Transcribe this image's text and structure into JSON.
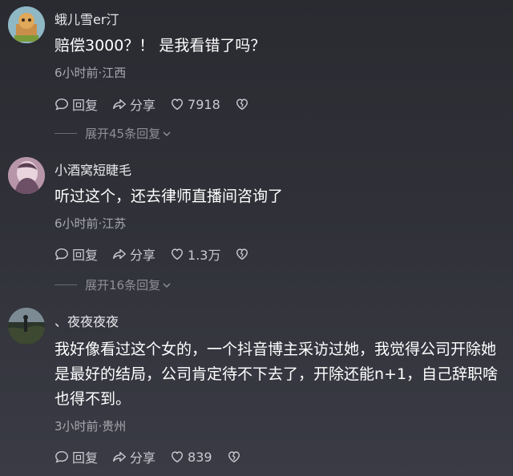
{
  "comments": [
    {
      "username": "蛾儿雪er汀",
      "text": "赔偿3000？！ 是我看错了吗？",
      "meta": "6小时前·江西",
      "reply_label": "回复",
      "share_label": "分享",
      "likes": "7918",
      "expand": "展开45条回复"
    },
    {
      "username": "小酒窝短睫毛",
      "text": "听过这个，还去律师直播间咨询了",
      "meta": "6小时前·江苏",
      "reply_label": "回复",
      "share_label": "分享",
      "likes": "1.3万",
      "expand": "展开16条回复"
    },
    {
      "username": "、夜夜夜夜",
      "text": "我好像看过这个女的，一个抖音博主采访过她，我觉得公司开除她是最好的结局，公司肯定待不下去了，开除还能n+1，自己辞职啥也得不到。",
      "meta": "3小时前·贵州",
      "reply_label": "回复",
      "share_label": "分享",
      "likes": "839"
    }
  ],
  "icons": {
    "reply": "comment-bubble-icon",
    "share": "share-arrow-icon",
    "like": "heart-icon",
    "dislike": "broken-heart-icon",
    "expand": "chevron-down-icon"
  },
  "colors": {
    "text": "#ffffff",
    "meta": "#a7a8b0",
    "action": "#c9cad1"
  }
}
